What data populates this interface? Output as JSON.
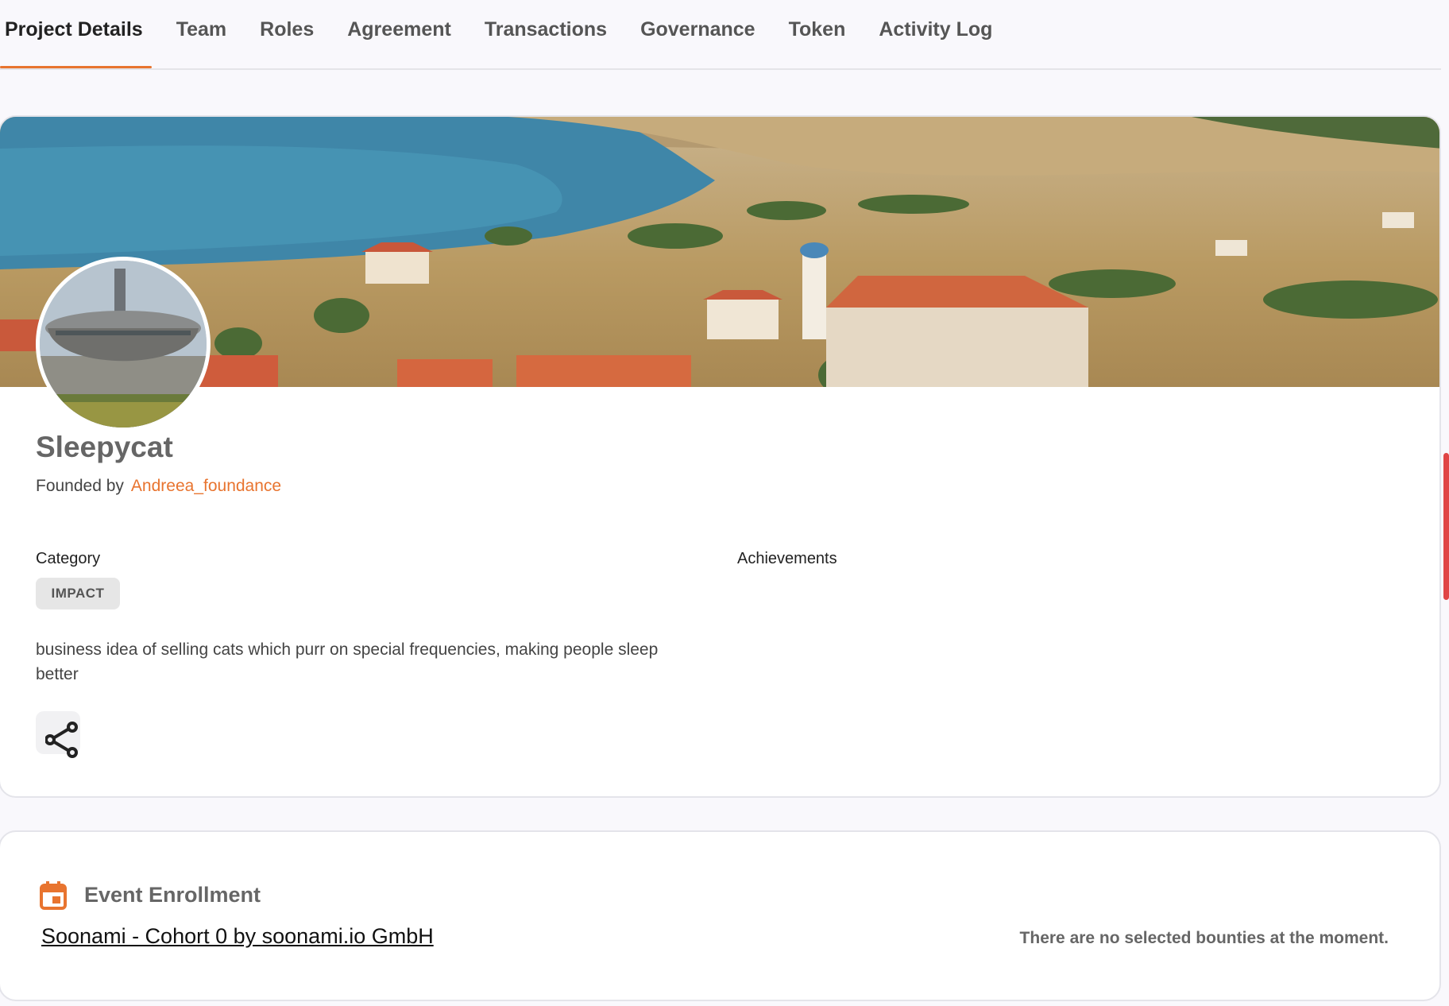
{
  "tabs": [
    {
      "label": "Project Details"
    },
    {
      "label": "Team"
    },
    {
      "label": "Roles"
    },
    {
      "label": "Agreement"
    },
    {
      "label": "Transactions"
    },
    {
      "label": "Governance"
    },
    {
      "label": "Token"
    },
    {
      "label": "Activity Log"
    }
  ],
  "project": {
    "name": "Sleepycat",
    "founded_prefix": "Founded by",
    "founder": "Andreea_foundance",
    "category_label": "Category",
    "category_value": "IMPACT",
    "achievements_label": "Achievements",
    "description": "business idea of selling cats which purr on special frequencies, making people sleep better",
    "share_icon": "share-icon"
  },
  "event": {
    "icon": "calendar-icon",
    "title": "Event Enrollment",
    "link_text": "Soonami - Cohort 0 by soonami.io GmbH",
    "no_bounties": "There are no selected bounties at the moment."
  },
  "colors": {
    "accent": "#e8742f",
    "scroll_indicator": "#e04545"
  }
}
